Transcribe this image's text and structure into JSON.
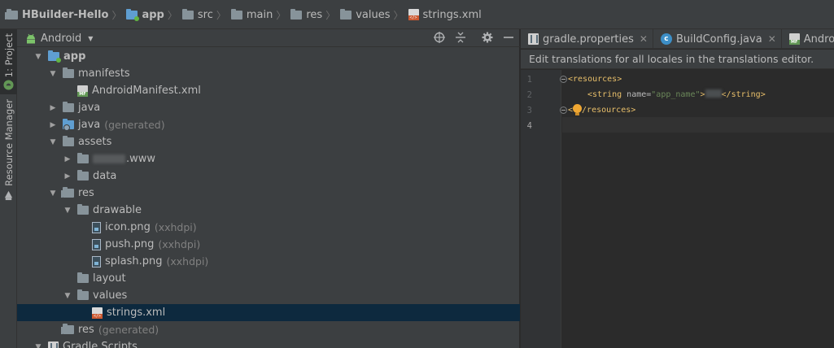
{
  "breadcrumb": [
    {
      "label": "HBuilder-Hello",
      "icon": "project-folder-icon",
      "bold": true
    },
    {
      "label": "app",
      "icon": "module-folder-icon",
      "bold": true
    },
    {
      "label": "src",
      "icon": "folder-icon",
      "bold": false
    },
    {
      "label": "main",
      "icon": "folder-icon",
      "bold": false
    },
    {
      "label": "res",
      "icon": "folder-icon",
      "bold": false
    },
    {
      "label": "values",
      "icon": "folder-icon",
      "bold": false
    },
    {
      "label": "strings.xml",
      "icon": "xml-file-icon",
      "bold": false
    }
  ],
  "toolstrip": {
    "project_tab": "1: Project",
    "resource_tab": "Resource Manager"
  },
  "project_panel": {
    "view_mode": "Android",
    "tree": [
      {
        "label": "app",
        "sub": "",
        "depth": 0,
        "toggle": "open",
        "icon": "module-folder-icon",
        "bold": true
      },
      {
        "label": "manifests",
        "sub": "",
        "depth": 1,
        "toggle": "open",
        "icon": "folder-icon"
      },
      {
        "label": "AndroidManifest.xml",
        "sub": "",
        "depth": 2,
        "toggle": "none",
        "icon": "manifest-file-icon"
      },
      {
        "label": "java",
        "sub": "",
        "depth": 1,
        "toggle": "closed",
        "icon": "folder-icon"
      },
      {
        "label": "java",
        "sub": "(generated)",
        "depth": 1,
        "toggle": "closed",
        "icon": "generated-folder-icon"
      },
      {
        "label": "assets",
        "sub": "",
        "depth": 1,
        "toggle": "open",
        "icon": "folder-icon"
      },
      {
        "label": ".www",
        "sub": "",
        "depth": 2,
        "toggle": "closed",
        "icon": "folder-icon",
        "blurred": true
      },
      {
        "label": "data",
        "sub": "",
        "depth": 2,
        "toggle": "closed",
        "icon": "folder-icon"
      },
      {
        "label": "res",
        "sub": "",
        "depth": 1,
        "toggle": "open",
        "icon": "res-folder-icon"
      },
      {
        "label": "drawable",
        "sub": "",
        "depth": 2,
        "toggle": "open",
        "icon": "folder-icon"
      },
      {
        "label": "icon.png",
        "sub": "(xxhdpi)",
        "depth": 3,
        "toggle": "none",
        "icon": "image-file-icon"
      },
      {
        "label": "push.png",
        "sub": "(xxhdpi)",
        "depth": 3,
        "toggle": "none",
        "icon": "image-file-icon"
      },
      {
        "label": "splash.png",
        "sub": "(xxhdpi)",
        "depth": 3,
        "toggle": "none",
        "icon": "image-file-icon"
      },
      {
        "label": "layout",
        "sub": "",
        "depth": 2,
        "toggle": "none",
        "icon": "folder-icon"
      },
      {
        "label": "values",
        "sub": "",
        "depth": 2,
        "toggle": "open",
        "icon": "folder-icon"
      },
      {
        "label": "strings.xml",
        "sub": "",
        "depth": 3,
        "toggle": "none",
        "icon": "xml-file-icon",
        "selected": true
      },
      {
        "label": "res",
        "sub": "(generated)",
        "depth": 1,
        "toggle": "none",
        "icon": "res-folder-icon"
      },
      {
        "label": "Gradle Scripts",
        "sub": "",
        "depth": 0,
        "toggle": "open",
        "icon": "gradle-icon"
      }
    ]
  },
  "editor": {
    "tabs": [
      {
        "label": "gradle.properties",
        "icon": "gradle-file-icon"
      },
      {
        "label": "BuildConfig.java",
        "icon": "class-file-icon"
      },
      {
        "label": "AndroidManifest.xml",
        "icon": "manifest-file-icon"
      }
    ],
    "banner": "Edit translations for all locales in the translations editor.",
    "line_numbers": [
      "1",
      "2",
      "3",
      "4"
    ],
    "code": {
      "l1": "<resources>",
      "l2_open": "<string",
      "l2_attr": " name=",
      "l2_val": "\"app_name\"",
      "l2_gt": ">",
      "l2_close": "</string>",
      "l3_a": "<",
      "l3_b": "/resources>"
    }
  },
  "colors": {
    "panel_bg": "#3c3f41",
    "editor_bg": "#2b2b2b",
    "selection": "#0d293e",
    "xml_tag": "#e8bf6a",
    "xml_value": "#6a8759"
  }
}
